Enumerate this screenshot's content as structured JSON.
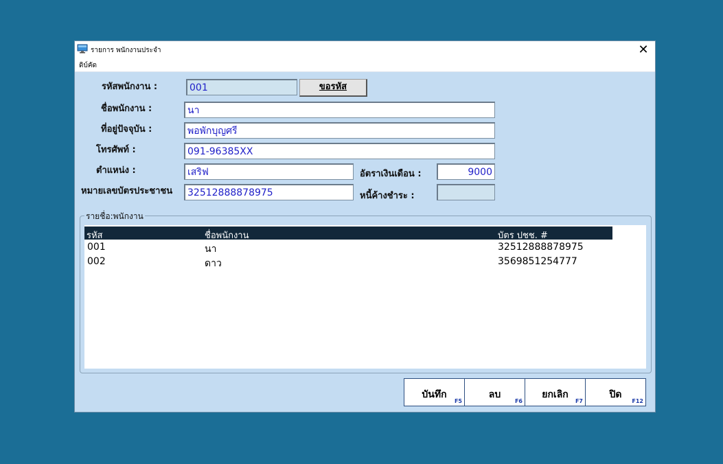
{
  "window": {
    "title": "รายการ พนักงานประจำ",
    "menu": [
      "ดิบ์คัด"
    ]
  },
  "form": {
    "code_label": "รหัสพนักงาน :",
    "code_value": "001",
    "get_code_button": "ขอรหัส",
    "name_label": "ชื่อพนักงาน :",
    "name_value": "นา",
    "address_label": "ที่อยู่ปัจจุบัน :",
    "address_value": "พอพักบุญศรี",
    "phone_label": "โทรศัพท์ :",
    "phone_value": "091-96385XX",
    "position_label": "ตำแหน่ง :",
    "position_value": "เสริฟ",
    "salary_label": "อัตราเงินเดือน :",
    "salary_value": "9000",
    "idcard_label": "หมายเลขบัตรประชาชน",
    "idcard_value": "32512888878975",
    "debt_label": "หนี้ค้างชำระ :",
    "debt_value": ""
  },
  "list": {
    "group_title": "รายชื่อ:พนักงาน",
    "headers": [
      "รหัส",
      "ชื่อพนักงาน",
      "บัตร ปชช. #"
    ],
    "rows": [
      [
        "001",
        "นา",
        "32512888878975"
      ],
      [
        "002",
        "ดาว",
        "3569851254777"
      ]
    ]
  },
  "buttons": [
    {
      "label": "บันทึก",
      "key": "F5"
    },
    {
      "label": "ลบ",
      "key": "F6"
    },
    {
      "label": "ยกเลิก",
      "key": "F7"
    },
    {
      "label": "ปิด",
      "key": "F12"
    }
  ]
}
